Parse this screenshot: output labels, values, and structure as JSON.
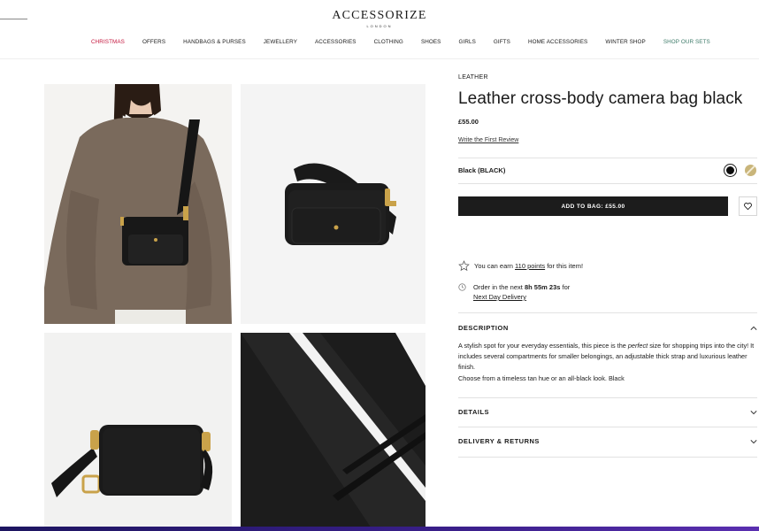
{
  "header": {
    "brand": "ACCESSORIZE",
    "brand_sub": "LONDON",
    "nav": [
      {
        "label": "CHRISTMAS",
        "style": "red"
      },
      {
        "label": "OFFERS",
        "style": ""
      },
      {
        "label": "HANDBAGS & PURSES",
        "style": ""
      },
      {
        "label": "JEWELLERY",
        "style": ""
      },
      {
        "label": "ACCESSORIES",
        "style": ""
      },
      {
        "label": "CLOTHING",
        "style": ""
      },
      {
        "label": "SHOES",
        "style": ""
      },
      {
        "label": "GIRLS",
        "style": ""
      },
      {
        "label": "GIFTS",
        "style": ""
      },
      {
        "label": "HOME ACCESSORIES",
        "style": ""
      },
      {
        "label": "WINTER SHOP",
        "style": ""
      },
      {
        "label": "SHOP OUR SETS",
        "style": "teal"
      }
    ]
  },
  "product": {
    "category": "LEATHER",
    "title": "Leather cross-body camera bag black",
    "price": "£55.00",
    "review_link": "Write the First Review",
    "colour_label": "Black (BLACK)",
    "swatches": [
      "black",
      "tan"
    ],
    "add_to_bag": "ADD TO BAG: £55.00",
    "earn_prefix": "You can earn",
    "earn_points": "110 points",
    "earn_suffix": "for this item!",
    "order_prefix": "Order in the next",
    "order_time": "8h 55m 23s",
    "order_suffix": "for",
    "delivery_link": "Next Day Delivery"
  },
  "accordion": {
    "description_title": "DESCRIPTION",
    "description_p1_a": "A stylish spot for your everyday essentials, this piece is the",
    "description_p1_em": "perfect",
    "description_p1_b": "size for shopping trips into the city! It includes several compartments for smaller belongings, an adjustable thick strap and luxurious leather finish.",
    "description_p2": "Choose from a timeless tan hue or an all-black look. Black",
    "details_title": "DETAILS",
    "delivery_title": "DELIVERY & RETURNS"
  },
  "colors": {
    "christmas_red": "#c4143c",
    "sets_teal": "#3c7a68",
    "button_dark": "#1c1c1c",
    "bag_black": "#151515",
    "hardware_gold": "#c9a24a"
  },
  "gallery": {
    "images": [
      "model-wearing-bag",
      "bag-front-view",
      "bag-side-view",
      "bag-leather-closeup"
    ]
  }
}
